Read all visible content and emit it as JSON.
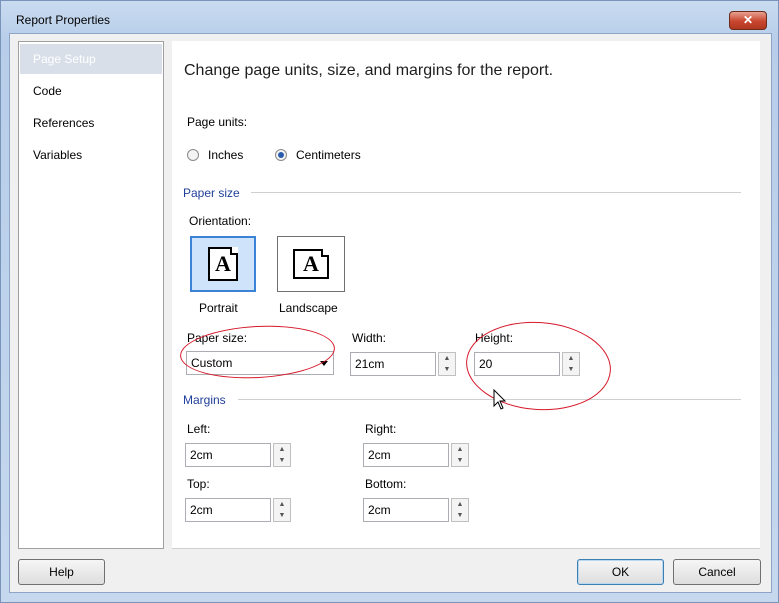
{
  "window": {
    "title": "Report Properties",
    "close_glyph": "✕"
  },
  "sidebar": {
    "items": [
      {
        "label": "Page Setup",
        "selected": true
      },
      {
        "label": "Code"
      },
      {
        "label": "References"
      },
      {
        "label": "Variables"
      }
    ]
  },
  "main": {
    "heading": "Change page units, size, and margins for the report.",
    "page_units": {
      "label": "Page units:",
      "options": [
        {
          "label": "Inches",
          "checked": false
        },
        {
          "label": "Centimeters",
          "checked": true
        }
      ]
    },
    "paper_size_section": {
      "title": "Paper size",
      "orientation_label": "Orientation:",
      "portrait_label": "Portrait",
      "landscape_label": "Landscape",
      "portrait_glyph": "A",
      "landscape_glyph": "A",
      "paper_size_label": "Paper size:",
      "paper_size_value": "Custom",
      "width_label": "Width:",
      "width_value": "21cm",
      "height_label": "Height:",
      "height_value": "20"
    },
    "margins_section": {
      "title": "Margins",
      "left_label": "Left:",
      "left_value": "2cm",
      "right_label": "Right:",
      "right_value": "2cm",
      "top_label": "Top:",
      "top_value": "2cm",
      "bottom_label": "Bottom:",
      "bottom_value": "2cm"
    }
  },
  "footer": {
    "help_label": "Help",
    "ok_label": "OK",
    "cancel_label": "Cancel"
  },
  "spinner": {
    "up": "▲",
    "down": "▼"
  },
  "colors": {
    "selection": "#d8dfe9",
    "section_title": "#1f3f9a",
    "annotation": "#d6182a",
    "close": "#c8452e"
  }
}
